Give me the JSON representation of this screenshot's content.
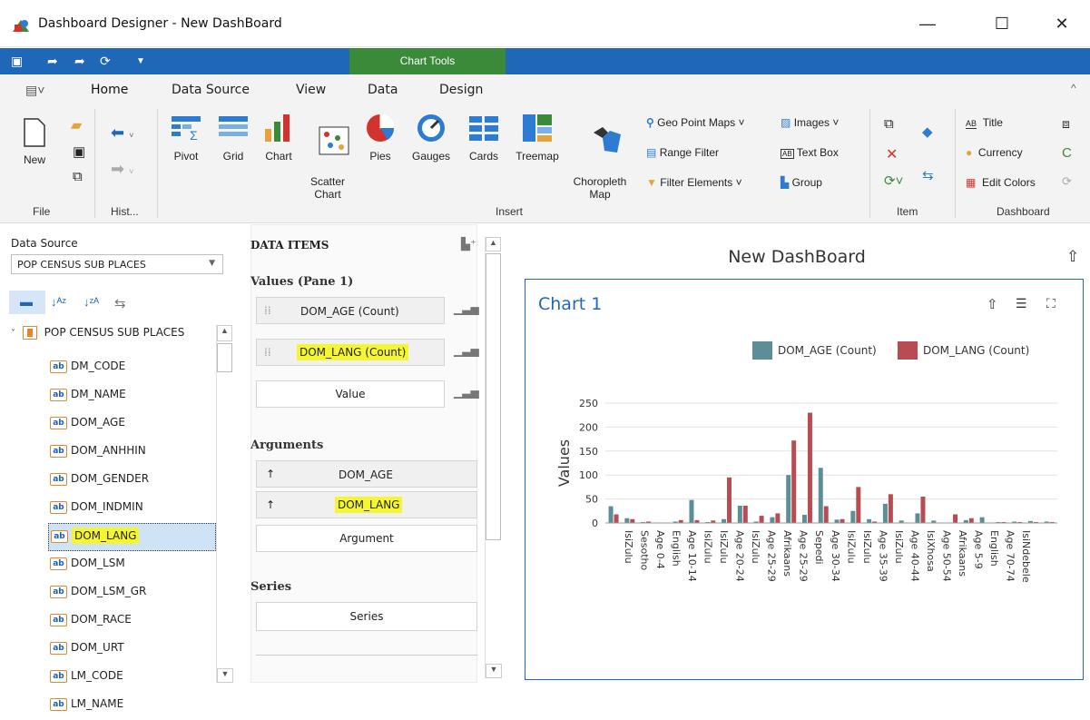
{
  "window": {
    "title": "Dashboard Designer - New DashBoard",
    "minimize": "—",
    "maximize": "☐",
    "close": "✕"
  },
  "context_tab": "Chart Tools",
  "tabs": [
    "Home",
    "Data Source",
    "View",
    "Data",
    "Design"
  ],
  "ribbon": {
    "file": {
      "new": "New",
      "group": "File"
    },
    "history": {
      "group": "Hist..."
    },
    "insert": {
      "group": "Insert",
      "items": [
        "Pivot",
        "Grid",
        "Chart",
        "Scatter\nChart",
        "Pies",
        "Gauges",
        "Cards",
        "Treemap",
        "Choropleth\nMap"
      ],
      "geo_point_maps": "Geo Point Maps",
      "range_filter": "Range Filter",
      "filter_elements": "Filter Elements",
      "images": "Images",
      "text_box": "Text Box",
      "group_btn": "Group"
    },
    "item": {
      "group": "Item"
    },
    "dashboard": {
      "group": "Dashboard",
      "title": "Title",
      "currency": "Currency",
      "edit_colors": "Edit Colors"
    }
  },
  "left": {
    "data_source_label": "Data Source",
    "data_source_value": "POP CENSUS SUB PLACES",
    "tree_root": "POP CENSUS SUB PLACES",
    "fields": [
      "DM_CODE",
      "DM_NAME",
      "DOM_AGE",
      "DOM_ANHHIN",
      "DOM_GENDER",
      "DOM_INDMIN",
      "DOM_LANG",
      "DOM_LSM",
      "DOM_LSM_GR",
      "DOM_RACE",
      "DOM_URT",
      "LM_CODE",
      "LM_NAME"
    ],
    "selected_field": "DOM_LANG",
    "field_icon": "ab"
  },
  "mid": {
    "header": "DATA ITEMS",
    "values_section": "Values (Pane 1)",
    "values": [
      "DOM_AGE (Count)",
      "DOM_LANG (Count)",
      "Value"
    ],
    "arguments_section": "Arguments",
    "arguments": [
      "DOM_AGE",
      "DOM_LANG",
      "Argument"
    ],
    "series_section": "Series",
    "series": [
      "Series"
    ]
  },
  "dashboard": {
    "title": "New DashBoard",
    "chart_title": "Chart 1"
  },
  "colors": {
    "accent": "#1f68b8",
    "chart_tools": "#3a8a3a",
    "series1": "#5b8e96",
    "series2": "#b84c52",
    "highlight": "#f5f531"
  },
  "chart_data": {
    "type": "bar",
    "ylabel": "Values",
    "ylim": [
      0,
      250
    ],
    "yticks": [
      0,
      50,
      100,
      150,
      200,
      250
    ],
    "legend_position": "top-right",
    "series": [
      {
        "name": "DOM_AGE (Count)",
        "values": [
          35,
          10,
          2,
          1,
          3,
          48,
          2,
          8,
          36,
          3,
          12,
          100,
          17,
          115,
          7,
          25,
          8,
          40,
          5,
          20,
          5,
          1,
          6,
          12,
          2,
          3,
          4,
          3
        ]
      },
      {
        "name": "DOM_LANG (Count)",
        "values": [
          18,
          8,
          3,
          1,
          6,
          6,
          5,
          95,
          36,
          15,
          20,
          172,
          230,
          35,
          8,
          75,
          3,
          60,
          1,
          55,
          1,
          18,
          10,
          1,
          2,
          2,
          2,
          2
        ]
      }
    ],
    "visible_tick_labels": [
      "IsiZulu",
      "Sesotho",
      "Age 0-4",
      "English",
      "Age 10-14",
      "IsiZulu",
      "IsiZulu",
      "Age 20-24",
      "IsiZulu",
      "Age 25-29",
      "Afrikaans",
      "Age 25-29",
      "Sepedi",
      "Age 30-34",
      "IsiZulu",
      "IsiZulu",
      "Age 35-39",
      "IsiZulu",
      "Age 40-44",
      "IsiXhosa",
      "Age 50-54",
      "Afrikaans",
      "Age 5-9",
      "English",
      "Age 70-74",
      "IsiNdebele"
    ]
  }
}
